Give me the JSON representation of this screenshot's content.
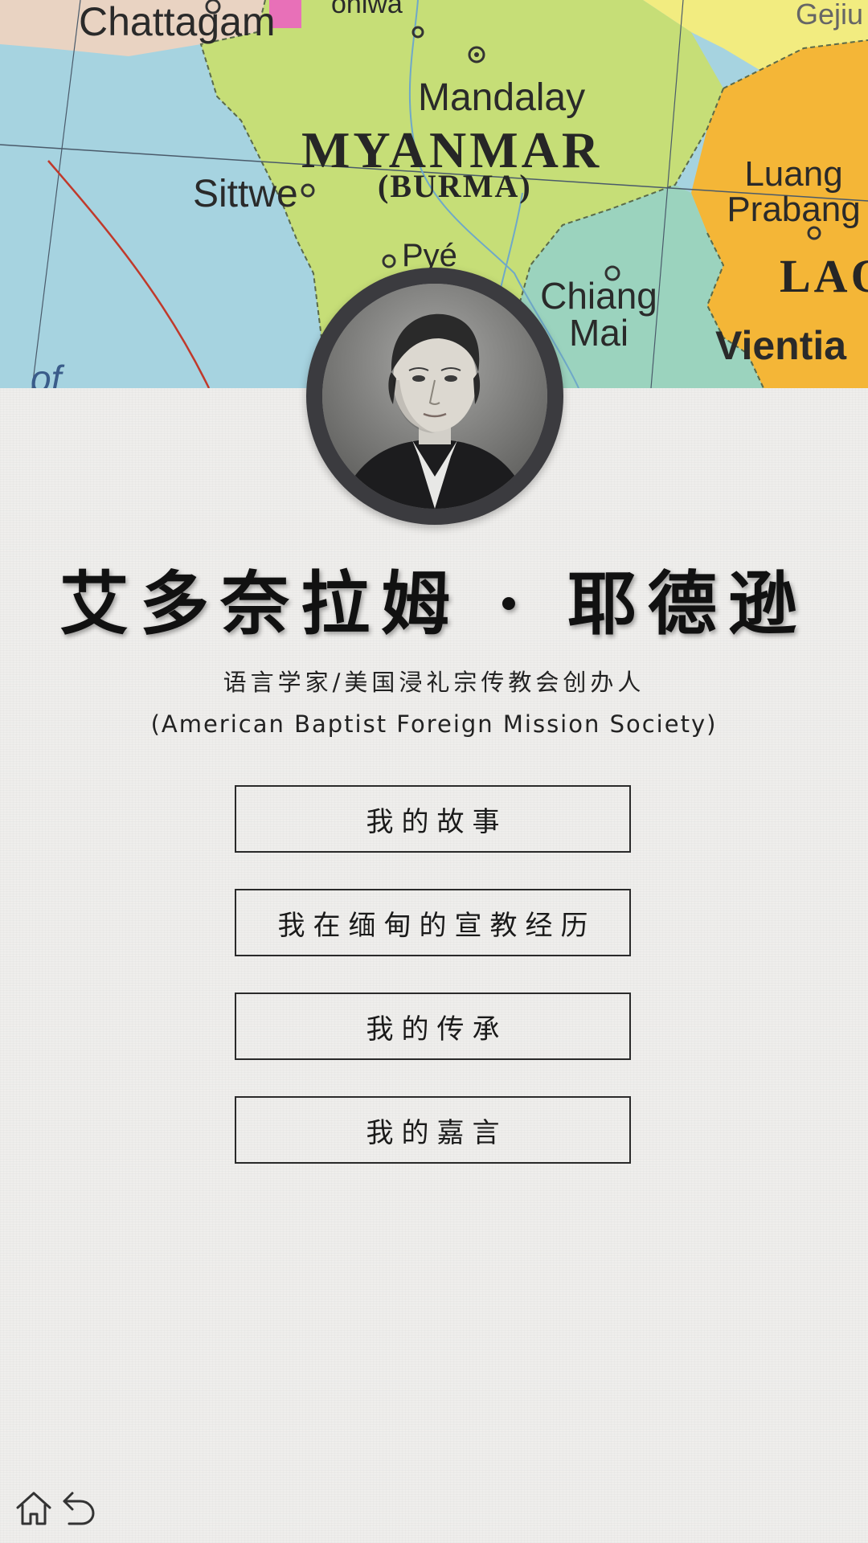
{
  "map": {
    "labels": {
      "chattagam": "Chattagam",
      "mandalay": "Mandalay",
      "country": "MYANMAR",
      "country_alt": "(BURMA)",
      "sittwe": "Sittwe",
      "pye": "Pyé",
      "chiang_mai": "Chiang Mai",
      "luang_prabang": "Luang Prabang",
      "laos": "LAO",
      "vientiane": "Vientia",
      "gejiu": "Gejiu",
      "monywa": "onlwa",
      "bay": "of"
    },
    "colors": {
      "sea": "#a6d3e0",
      "myanmar": "#c6de77",
      "laos": "#f4b637",
      "thailand": "#9bd3be",
      "china": "#f2ec80"
    }
  },
  "profile": {
    "portrait_alt": "portrait",
    "name": "艾多奈拉姆 · 耶德逊",
    "subtitle": "语言学家/美国浸礼宗传教会创办人",
    "subtitle_en": "(American Baptist Foreign Mission Society)"
  },
  "menu": {
    "items": [
      {
        "label": "我的故事"
      },
      {
        "label": "我在缅甸的宣教经历"
      },
      {
        "label": "我的传承"
      },
      {
        "label": "我的嘉言"
      }
    ]
  },
  "nav": {
    "home_icon": "home-icon",
    "back_icon": "back-icon"
  }
}
